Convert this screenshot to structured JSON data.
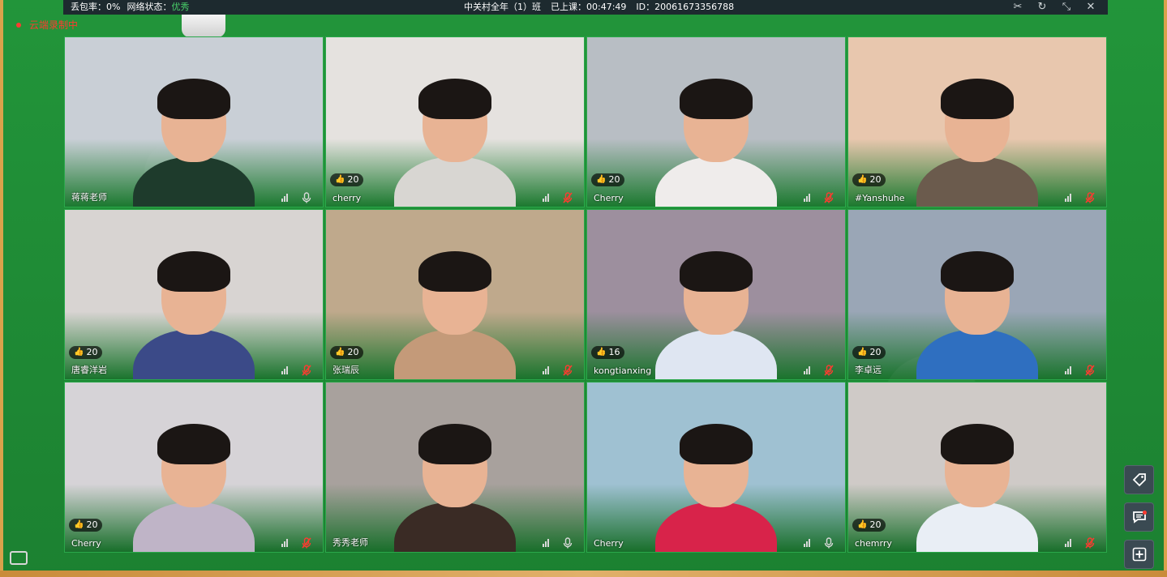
{
  "topbar": {
    "packet_loss_label": "丢包率：0%",
    "network_label": "网络状态：",
    "network_value": "优秀",
    "class_name": "中关村全年（1）班",
    "elapsed": "已上课：00:47:49",
    "room_id": "ID：20061673356788",
    "controls": [
      "scissors-icon",
      "refresh-icon",
      "collapse-icon",
      "close-icon"
    ]
  },
  "recording": {
    "label": "云端录制中"
  },
  "colors": {
    "board": "#1f8a34",
    "tile_border": "#2aa84a",
    "good": "#49d16a",
    "recording": "#ff3b30",
    "likes_thumb": "#f5b400"
  },
  "tiles": [
    {
      "name": "蒋蒋老师",
      "likes": "",
      "mic": "on",
      "bg": "#c9cfd6",
      "shirt": "#1e3b2c"
    },
    {
      "name": "cherry",
      "likes": "20",
      "mic": "muted",
      "bg": "#e5e2df",
      "shirt": "#d8d6d2"
    },
    {
      "name": "Cherry",
      "likes": "20",
      "mic": "muted",
      "bg": "#b8bec4",
      "shirt": "#efeceb"
    },
    {
      "name": "#Yanshuhe",
      "likes": "20",
      "mic": "muted",
      "bg": "#e8c7ae",
      "shirt": "#6b5b4d"
    },
    {
      "name": "唐睿洋岩",
      "likes": "20",
      "mic": "muted",
      "bg": "#d8d4d2",
      "shirt": "#3b4a88"
    },
    {
      "name": "张瑞辰",
      "likes": "20",
      "mic": "muted",
      "bg": "#bfa98c",
      "shirt": "#c49a79"
    },
    {
      "name": "kongtianxing",
      "likes": "16",
      "mic": "muted",
      "bg": "#9d8f9e",
      "shirt": "#dfe6f2"
    },
    {
      "name": "李卓远",
      "likes": "20",
      "mic": "muted",
      "bg": "#9aa6b6",
      "shirt": "#2f6fc0"
    },
    {
      "name": "Cherry",
      "likes": "20",
      "mic": "muted",
      "bg": "#d6d3d7",
      "shirt": "#bfb4c7"
    },
    {
      "name": "秀秀老师",
      "likes": "",
      "mic": "on",
      "bg": "#a8a19d",
      "shirt": "#3a2b25"
    },
    {
      "name": "Cherry",
      "likes": "",
      "mic": "on",
      "bg": "#9fc1d2",
      "shirt": "#d8234a"
    },
    {
      "name": "chemrry",
      "likes": "20",
      "mic": "muted",
      "bg": "#cfcac7",
      "shirt": "#e9eef5"
    }
  ],
  "side_buttons": [
    "tag-icon",
    "chat-icon",
    "add-icon"
  ]
}
